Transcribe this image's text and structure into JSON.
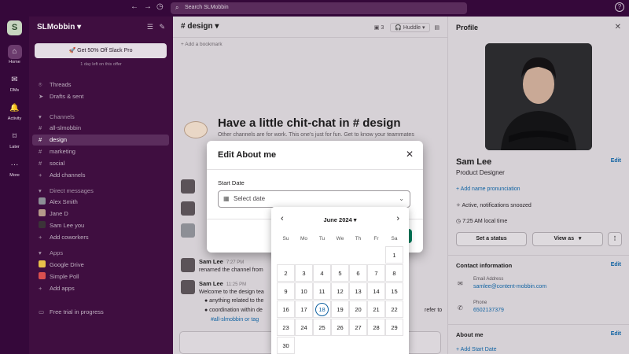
{
  "topbar": {
    "back_icon": "arrow-left-icon",
    "forward_icon": "arrow-right-icon",
    "history_icon": "clock-icon",
    "search_placeholder": "Search SLMobbin",
    "help_label": "?"
  },
  "rail": {
    "workspace_initial": "S",
    "items": [
      {
        "label": "Home",
        "icon": "home-icon",
        "glyph": "⌂"
      },
      {
        "label": "DMs",
        "icon": "dm-icon",
        "glyph": "✉"
      },
      {
        "label": "Activity",
        "icon": "bell-icon",
        "glyph": "🔔"
      },
      {
        "label": "Later",
        "icon": "bookmark-icon",
        "glyph": "⌑"
      },
      {
        "label": "More",
        "icon": "more-icon",
        "glyph": "···"
      }
    ]
  },
  "sidebar": {
    "workspace_name": "SLMobbin ▾",
    "promo_label": "🚀 Get 50% Off Slack Pro",
    "promo_sub": "1 day left on this offer",
    "threads": "Threads",
    "drafts": "Drafts & sent",
    "channels_header": "Channels",
    "channels": [
      "all-slmobbin",
      "design",
      "marketing",
      "social"
    ],
    "add_channels": "Add channels",
    "dm_header": "Direct messages",
    "dms": [
      "Alex Smith",
      "Jane D",
      "Sam Lee  you"
    ],
    "add_coworkers": "Add coworkers",
    "apps_header": "Apps",
    "apps": [
      "Google Drive",
      "Simple Poll"
    ],
    "add_apps": "Add apps",
    "trial": "Free trial in progress"
  },
  "channel": {
    "title": "# design ▾",
    "member_count": "3",
    "huddle_label": "Huddle",
    "bookmark": "+ Add a bookmark",
    "welcome_title": "Have a little chit-chat in # design",
    "welcome_sub": "Other channels are for work. This one's just for fun. Get to know your teammates",
    "messages": [
      {
        "name": "Sam Lee",
        "time": "7:27 PM",
        "text": "renamed the channel from"
      },
      {
        "name": "Sam Lee",
        "time": "11:25 PM",
        "text": "Welcome to the design tea"
      }
    ],
    "bullets": [
      "●  anything related to the",
      "●  coordination within de"
    ],
    "tag_text": "#all-slmobbin  or tag",
    "refer_text": "refer to"
  },
  "profile": {
    "title": "Profile",
    "name": "Sam Lee",
    "role": "Product Designer",
    "edit": "Edit",
    "add_pronunciation": "+ Add name pronunciation",
    "status": "Active, notifications snoozed",
    "local_time": "7:25 AM local time",
    "set_status": "Set a status",
    "view_as": "View as",
    "contact_header": "Contact information",
    "email_label": "Email Address",
    "email": "samlee@content-mobbin.com",
    "phone_label": "Phone",
    "phone": "6502137379",
    "about_header": "About me",
    "add_start_date": "+ Add Start Date"
  },
  "modal": {
    "title": "Edit About me",
    "field_label": "Start Date",
    "placeholder": "Select date"
  },
  "calendar": {
    "month": "June 2024 ▾",
    "dow": [
      "Su",
      "Mo",
      "Tu",
      "We",
      "Th",
      "Fr",
      "Sa"
    ],
    "first_weekday": 6,
    "days_in_month": 30,
    "today": 18
  }
}
